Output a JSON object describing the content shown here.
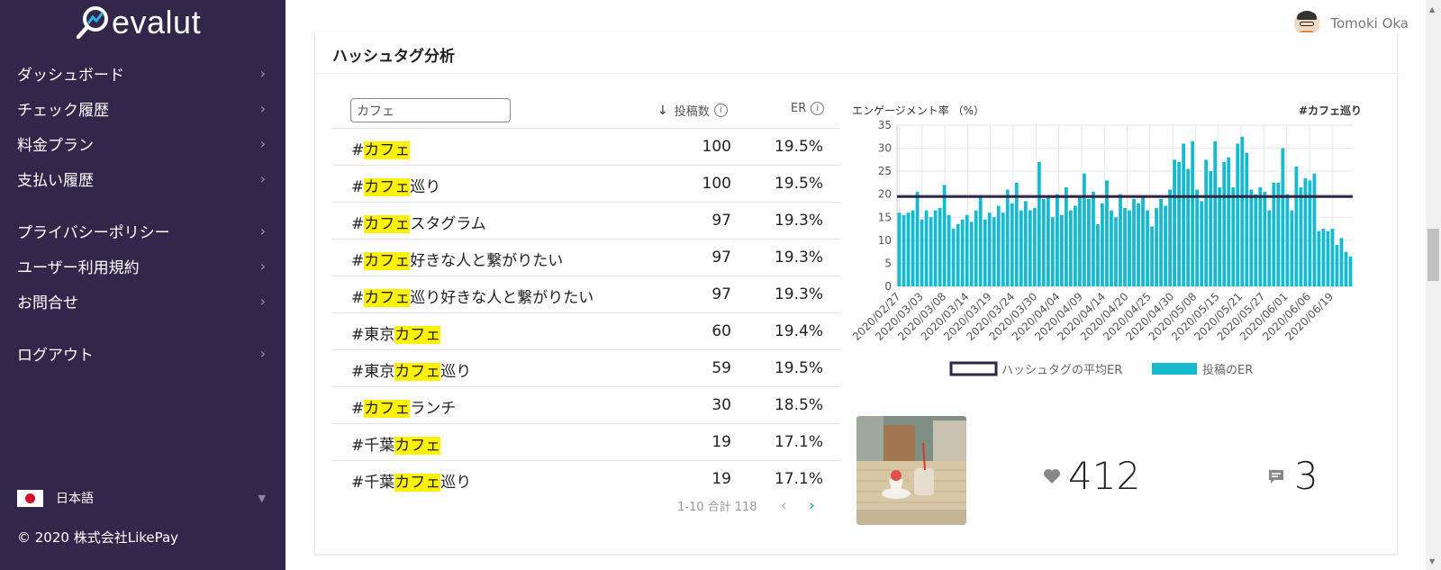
{
  "app": {
    "name": "evalut"
  },
  "sidebar": {
    "items": [
      {
        "label": "ダッシュボード"
      },
      {
        "label": "チェック履歴"
      },
      {
        "label": "料金プラン"
      },
      {
        "label": "支払い履歴"
      },
      {
        "label": "プライバシーポリシー"
      },
      {
        "label": "ユーザー利用規約"
      },
      {
        "label": "お問合せ"
      },
      {
        "label": "ログアウト"
      }
    ],
    "language": "日本語",
    "copyright": "© 2020 株式会社LikePay"
  },
  "header": {
    "user_name": "Tomoki Oka"
  },
  "section": {
    "title": "ハッシュタグ分析",
    "search_value": "カフェ",
    "columns": {
      "posts": "投稿数",
      "er": "ER"
    },
    "rows": [
      {
        "prefix": "#",
        "highlight": "カフェ",
        "suffix": "",
        "posts": "100",
        "er": "19.5%"
      },
      {
        "prefix": "#",
        "highlight": "カフェ",
        "suffix": "巡り",
        "posts": "100",
        "er": "19.5%"
      },
      {
        "prefix": "#",
        "highlight": "カフェ",
        "suffix": "スタグラム",
        "posts": "97",
        "er": "19.3%"
      },
      {
        "prefix": "#",
        "highlight": "カフェ",
        "suffix": "好きな人と繋がりたい",
        "posts": "97",
        "er": "19.3%"
      },
      {
        "prefix": "#",
        "highlight": "カフェ",
        "suffix": "巡り好きな人と繋がりたい",
        "posts": "97",
        "er": "19.3%"
      },
      {
        "prefix": "#東京",
        "highlight": "カフェ",
        "suffix": "",
        "posts": "60",
        "er": "19.4%"
      },
      {
        "prefix": "#東京",
        "highlight": "カフェ",
        "suffix": "巡り",
        "posts": "59",
        "er": "19.5%"
      },
      {
        "prefix": "#",
        "highlight": "カフェ",
        "suffix": "ランチ",
        "posts": "30",
        "er": "18.5%"
      },
      {
        "prefix": "#千葉",
        "highlight": "カフェ",
        "suffix": "",
        "posts": "19",
        "er": "17.1%"
      },
      {
        "prefix": "#千葉",
        "highlight": "カフェ",
        "suffix": "巡り",
        "posts": "19",
        "er": "17.1%"
      }
    ],
    "pagination": "1-10 合計 118",
    "post": {
      "likes": "412",
      "comments": "3"
    }
  },
  "colors": {
    "sidebar": "#33264b",
    "bar": "#17b9cf",
    "avg_line": "#2f2545",
    "highlight": "#fff200",
    "accent": "#2aa8d6"
  },
  "chart_data": {
    "type": "bar",
    "title": "#カフェ巡り",
    "ylabel": "エンゲージメント率 （%）",
    "ylim": [
      0,
      35
    ],
    "yticks": [
      0,
      5,
      10,
      15,
      20,
      25,
      30,
      35
    ],
    "x_tick_labels": [
      "2020/02/27",
      "2020/03/03",
      "2020/03/08",
      "2020/03/14",
      "2020/03/19",
      "2020/03/24",
      "2020/03/30",
      "2020/04/04",
      "2020/04/09",
      "2020/04/14",
      "2020/04/20",
      "2020/04/25",
      "2020/04/30",
      "2020/05/08",
      "2020/05/15",
      "2020/05/21",
      "2020/05/27",
      "2020/06/01",
      "2020/06/06",
      "2020/06/19"
    ],
    "series": [
      {
        "name": "ハッシュタグの平均ER",
        "type": "line",
        "value": 19.5
      },
      {
        "name": "投稿のER",
        "type": "bar",
        "values": [
          16,
          15.5,
          16,
          16.5,
          20.5,
          14.5,
          16.5,
          15,
          16.5,
          17,
          22,
          15.5,
          12.5,
          13.5,
          14.5,
          15.5,
          14,
          16.5,
          19.5,
          14.5,
          16,
          15,
          17.5,
          16,
          21,
          18,
          22.5,
          16.5,
          18.5,
          16.5,
          17,
          27,
          19,
          19.5,
          15,
          20,
          15.5,
          21.5,
          16.5,
          17.5,
          19.5,
          24.5,
          19,
          20.5,
          13.5,
          18,
          23,
          16.5,
          15,
          20,
          17,
          16.5,
          19,
          18,
          19.5,
          16.5,
          13,
          17,
          19,
          17.5,
          21,
          27.5,
          27,
          31,
          25.5,
          31.5,
          21,
          18.5,
          27.5,
          25,
          31.5,
          21.5,
          27,
          28,
          21.5,
          31,
          32.5,
          29,
          21,
          20,
          21.5,
          20.5,
          16.5,
          22.5,
          22.5,
          30,
          20,
          16.5,
          26,
          21.5,
          23.5,
          23,
          24.5,
          12,
          12.5,
          12,
          12.5,
          9,
          10.5,
          7.5,
          6.5
        ]
      }
    ],
    "legend": "bottom"
  }
}
